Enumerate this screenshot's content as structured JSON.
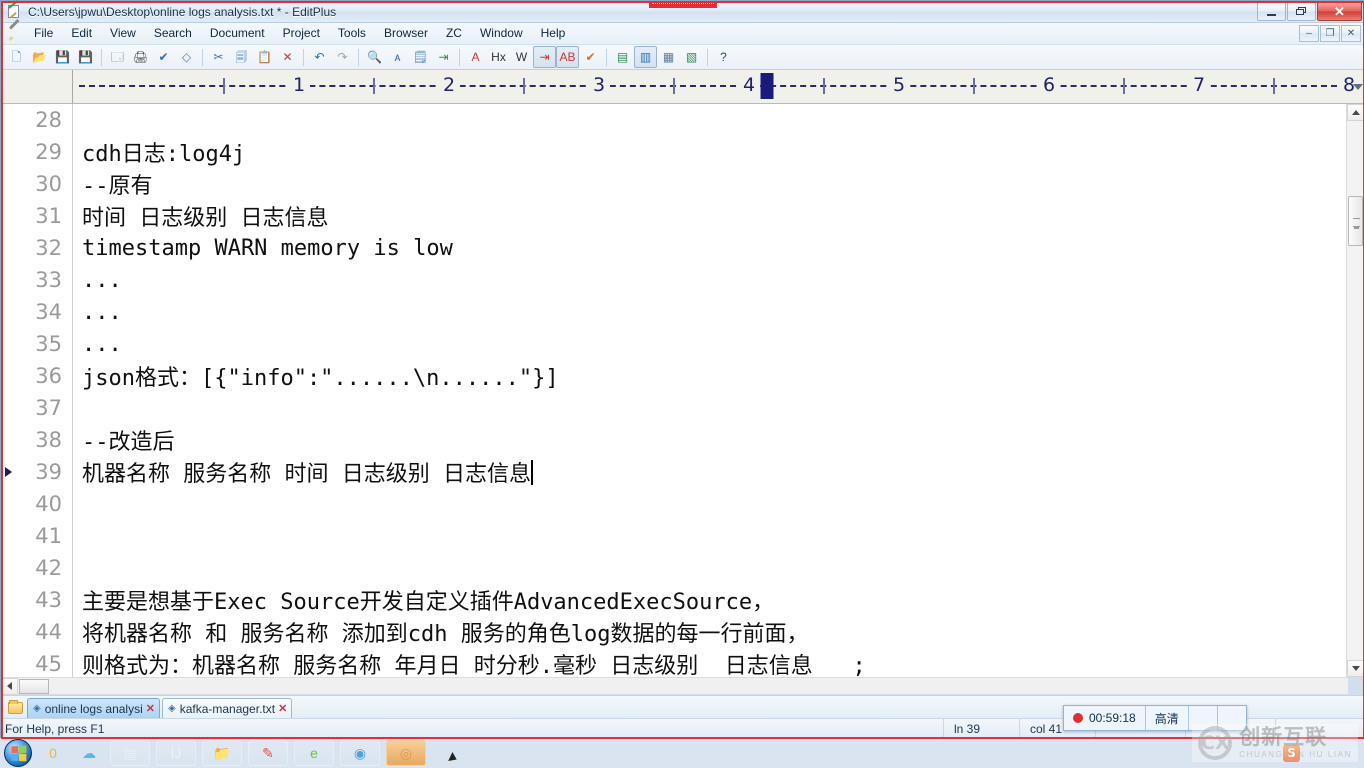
{
  "window": {
    "title": "C:\\Users\\jpwu\\Desktop\\online logs analysis.txt * - EditPlus",
    "app_icon": "editplus-icon",
    "buttons": {
      "minimize": "minimize-icon",
      "restore": "restore-icon",
      "close": "✕"
    },
    "mdi_buttons": {
      "minimize": "–",
      "restore": "❐",
      "close": "✕"
    }
  },
  "menu": {
    "items": [
      {
        "label": "File"
      },
      {
        "label": "Edit"
      },
      {
        "label": "View"
      },
      {
        "label": "Search"
      },
      {
        "label": "Document"
      },
      {
        "label": "Project"
      },
      {
        "label": "Tools"
      },
      {
        "label": "Browser"
      },
      {
        "label": "ZC"
      },
      {
        "label": "Window"
      },
      {
        "label": "Help"
      }
    ]
  },
  "toolbar": {
    "buttons": [
      {
        "name": "new-file-icon",
        "glyph": "🗋",
        "color": "#4c7fc0",
        "framed": false
      },
      {
        "name": "open-file-icon",
        "glyph": "📂",
        "color": "#d8a13a",
        "framed": false
      },
      {
        "name": "save-icon",
        "glyph": "💾",
        "color": "#2f8f4e",
        "framed": false
      },
      {
        "name": "save-all-icon",
        "glyph": "💾",
        "color": "#2f8f4e",
        "framed": false
      },
      {
        "name": "separator",
        "glyph": "",
        "color": "",
        "framed": false
      },
      {
        "name": "print-preview-icon",
        "glyph": "🗔",
        "color": "#5b7b9a",
        "framed": false
      },
      {
        "name": "print-icon",
        "glyph": "🖨",
        "color": "#4a4a4a",
        "framed": false
      },
      {
        "name": "spell-check-icon",
        "glyph": "✔",
        "color": "#2f6fb5",
        "framed": false
      },
      {
        "name": "view-in-browser-icon",
        "glyph": "◇",
        "color": "#4c7fc0",
        "framed": false
      },
      {
        "name": "separator",
        "glyph": "",
        "color": "",
        "framed": false
      },
      {
        "name": "cut-icon",
        "glyph": "✂",
        "color": "#3f6fae",
        "framed": false
      },
      {
        "name": "copy-icon",
        "glyph": "🗐",
        "color": "#4c7fc0",
        "framed": false
      },
      {
        "name": "paste-icon",
        "glyph": "📋",
        "color": "#8c7a4a",
        "framed": false
      },
      {
        "name": "delete-icon",
        "glyph": "✕",
        "color": "#cc3b30",
        "framed": false
      },
      {
        "name": "separator",
        "glyph": "",
        "color": "",
        "framed": false
      },
      {
        "name": "undo-icon",
        "glyph": "↶",
        "color": "#2f6fb5",
        "framed": false
      },
      {
        "name": "redo-icon",
        "glyph": "↷",
        "color": "#9aa7b4",
        "framed": false
      },
      {
        "name": "separator",
        "glyph": "",
        "color": "",
        "framed": false
      },
      {
        "name": "find-icon",
        "glyph": "🔍",
        "color": "#6a4fa0",
        "framed": false
      },
      {
        "name": "replace-icon",
        "glyph": "ᴀ",
        "color": "#3f6fae",
        "framed": false
      },
      {
        "name": "find-in-files-icon",
        "glyph": "🗒",
        "color": "#4c7fc0",
        "framed": false
      },
      {
        "name": "goto-line-icon",
        "glyph": "⇥",
        "color": "#3f8f3f",
        "framed": false
      },
      {
        "name": "separator",
        "glyph": "",
        "color": "",
        "framed": false
      },
      {
        "name": "font-icon",
        "glyph": "A",
        "color": "#cc3b30",
        "framed": false
      },
      {
        "name": "hex-view-icon",
        "glyph": "Hx",
        "color": "#333333",
        "framed": false
      },
      {
        "name": "word-wrap-icon",
        "glyph": "W",
        "color": "#333333",
        "framed": false
      },
      {
        "name": "indent-icon",
        "glyph": "⇥",
        "color": "#cc3b30",
        "framed": true
      },
      {
        "name": "sort-icon",
        "glyph": "AB",
        "color": "#cc3b30",
        "framed": true
      },
      {
        "name": "check-mark-icon",
        "glyph": "✔",
        "color": "#e06a2a",
        "framed": false
      },
      {
        "name": "separator",
        "glyph": "",
        "color": "",
        "framed": false
      },
      {
        "name": "document-selector-icon",
        "glyph": "▤",
        "color": "#2f8f4e",
        "framed": false
      },
      {
        "name": "directory-window-icon",
        "glyph": "▥",
        "color": "#2f6fb5",
        "framed": true
      },
      {
        "name": "clip-library-icon",
        "glyph": "▦",
        "color": "#5b7b9a",
        "framed": false
      },
      {
        "name": "output-window-icon",
        "glyph": "▧",
        "color": "#2f8f4e",
        "framed": false
      },
      {
        "name": "separator",
        "glyph": "",
        "color": "",
        "framed": false
      },
      {
        "name": "context-help-icon",
        "glyph": "?",
        "color": "#2f4f7f",
        "framed": false
      }
    ]
  },
  "ruler": {
    "numbers": [
      "1",
      "2",
      "3",
      "4",
      "5",
      "6",
      "7",
      "8"
    ],
    "caret_at": "4"
  },
  "editor": {
    "lines": [
      {
        "no": "28",
        "text": "",
        "current": false
      },
      {
        "no": "29",
        "text": "cdh日志:log4j",
        "current": false
      },
      {
        "no": "30",
        "text": "--原有",
        "current": false
      },
      {
        "no": "31",
        "text": "时间 日志级别 日志信息",
        "current": false
      },
      {
        "no": "32",
        "text": "timestamp WARN memory is low",
        "current": false
      },
      {
        "no": "33",
        "text": "...",
        "current": false
      },
      {
        "no": "34",
        "text": "...",
        "current": false
      },
      {
        "no": "35",
        "text": "...",
        "current": false
      },
      {
        "no": "36",
        "text": "json格式：[{\"info\":\"......\\n......\"}]",
        "current": false
      },
      {
        "no": "37",
        "text": "",
        "current": false
      },
      {
        "no": "38",
        "text": "--改造后",
        "current": false
      },
      {
        "no": "39",
        "text": "机器名称 服务名称 时间 日志级别 日志信息",
        "current": true
      },
      {
        "no": "40",
        "text": "",
        "current": false
      },
      {
        "no": "41",
        "text": "",
        "current": false
      },
      {
        "no": "42",
        "text": "",
        "current": false
      },
      {
        "no": "43",
        "text": "主要是想基于Exec Source开发自定义插件AdvancedExecSource，",
        "current": false
      },
      {
        "no": "44",
        "text": "将机器名称 和 服务名称 添加到cdh 服务的角色log数据的每一行前面，",
        "current": false
      },
      {
        "no": "45",
        "text": "则格式为：机器名称 服务名称 年月日 时分秒.毫秒 日志级别  日志信息   ;",
        "current": false
      }
    ]
  },
  "tabs": {
    "folder_icon": "folder-icon",
    "items": [
      {
        "label": "online logs analysi",
        "active": true,
        "close": "✕",
        "dot": "◈"
      },
      {
        "label": "kafka-manager.txt",
        "active": false,
        "close": "✕",
        "dot": "◈"
      }
    ]
  },
  "status": {
    "help": "For Help, press F1",
    "line": "ln 39",
    "col": "col 41"
  },
  "recorder": {
    "time": "00:59:18",
    "quality": "高清",
    "record_dot": "record-dot"
  },
  "watermark": {
    "logo": "CX",
    "main": "创新互联",
    "sub": "CHUANG XIN HU LIAN"
  },
  "taskbar": {
    "start": "windows-start-orb",
    "items": [
      {
        "name": "taskbar-quicklaunch-notes",
        "glyph": "0",
        "color": "#e8b93c",
        "active": false,
        "plain": true
      },
      {
        "name": "taskbar-quicklaunch-cloud",
        "glyph": "☁",
        "color": "#55b9e8",
        "active": false,
        "plain": true
      },
      {
        "name": "taskbar-item-remote-desktop",
        "glyph": "▤",
        "color": "#e9eef5",
        "active": false,
        "plain": false
      },
      {
        "name": "taskbar-item-intellij",
        "glyph": "IJ",
        "color": "#f2f2f2",
        "active": false,
        "plain": false
      },
      {
        "name": "taskbar-item-explorer",
        "glyph": "📁",
        "color": "#f0c86a",
        "active": false,
        "plain": false
      },
      {
        "name": "taskbar-item-editplus",
        "glyph": "✎",
        "color": "#d9534f",
        "active": false,
        "plain": false
      },
      {
        "name": "taskbar-item-browser",
        "glyph": "e",
        "color": "#6fbf4a",
        "active": false,
        "plain": false
      },
      {
        "name": "taskbar-item-player",
        "glyph": "◉",
        "color": "#4fa3dd",
        "active": false,
        "plain": false
      },
      {
        "name": "taskbar-item-recorder",
        "glyph": "◎",
        "color": "#e09a4a",
        "active": true,
        "plain": false
      }
    ],
    "tray": {
      "sogou": "S",
      "expand": "▲",
      "network": "⚑",
      "volume": "◫"
    }
  }
}
